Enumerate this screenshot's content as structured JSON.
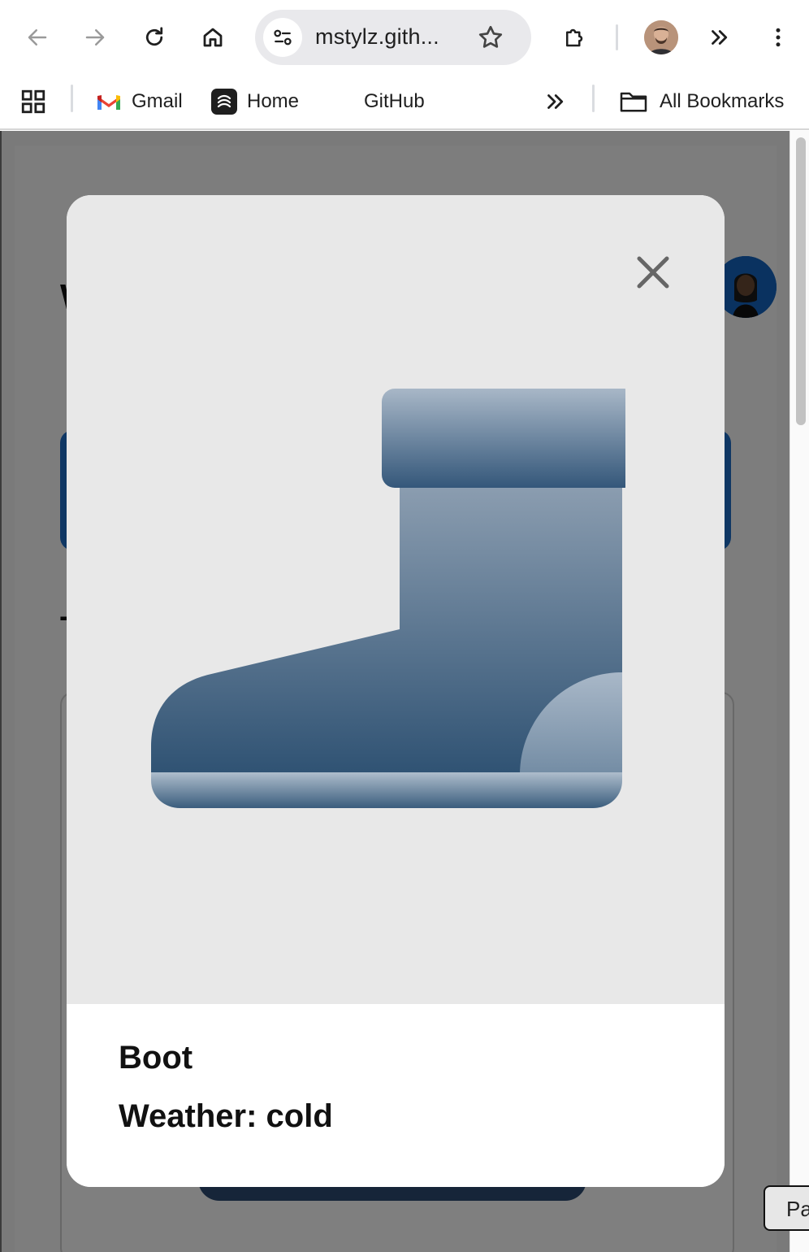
{
  "browser": {
    "url": "mstylz.gith...",
    "bookmarks": [
      {
        "label": "Gmail"
      },
      {
        "label": "Home"
      },
      {
        "label": "GitHub"
      }
    ],
    "all_bookmarks_label": "All Bookmarks"
  },
  "page": {
    "corner_button_label": "Pa"
  },
  "modal": {
    "item_name": "Boot",
    "weather_text": "Weather: cold"
  },
  "colors": {
    "scrim": "#000000",
    "modal_image_bg": "#e8e8e8",
    "boot_dark": "#2e5070",
    "boot_light": "#a5b5c6"
  }
}
